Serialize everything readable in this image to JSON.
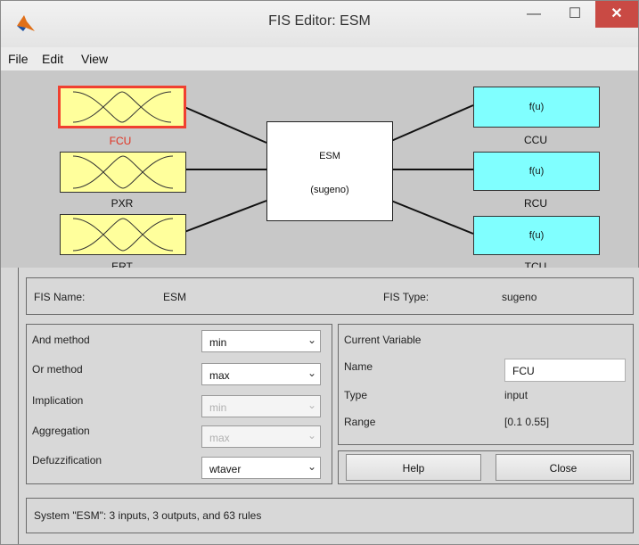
{
  "window": {
    "title": "FIS Editor: ESM",
    "minimize": "—",
    "maximize": "☐",
    "close": "✕"
  },
  "menu": [
    "File",
    "Edit",
    "View"
  ],
  "inputs": [
    {
      "name": "FCU",
      "selected": true
    },
    {
      "name": "PXR",
      "selected": false
    },
    {
      "name": "ERT",
      "selected": false
    }
  ],
  "outputs": [
    {
      "name": "CCU",
      "func": "f(u)"
    },
    {
      "name": "RCU",
      "func": "f(u)"
    },
    {
      "name": "TCU",
      "func": "f(u)"
    }
  ],
  "fis": {
    "name": "ESM",
    "type_paren": "(sugeno)"
  },
  "info": {
    "fis_name_label": "FIS Name:",
    "fis_name": "ESM",
    "fis_type_label": "FIS Type:",
    "fis_type": "sugeno"
  },
  "methods": {
    "and_label": "And method",
    "and_value": "min",
    "or_label": "Or method",
    "or_value": "max",
    "implication_label": "Implication",
    "implication_value": "min",
    "aggregation_label": "Aggregation",
    "aggregation_value": "max",
    "defuzz_label": "Defuzzification",
    "defuzz_value": "wtaver"
  },
  "current_variable": {
    "title": "Current Variable",
    "name_label": "Name",
    "name_value": "FCU",
    "type_label": "Type",
    "type_value": "input",
    "range_label": "Range",
    "range_value": "[0.1 0.55]"
  },
  "buttons": {
    "help": "Help",
    "close": "Close"
  },
  "status": "System \"ESM\": 3 inputs, 3 outputs, and 63 rules",
  "colors": {
    "input_fill": "#ffff9c",
    "output_fill": "#80ffff",
    "selected_border": "#f04030",
    "selected_label": "#e03020"
  }
}
